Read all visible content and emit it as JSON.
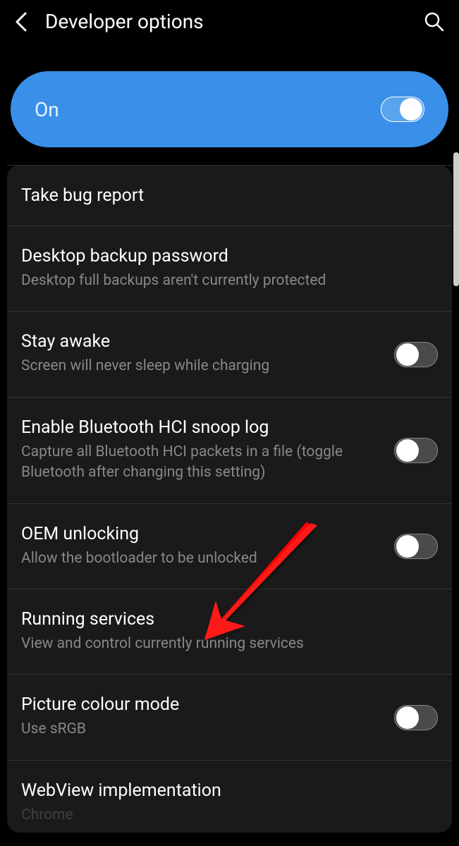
{
  "header": {
    "title": "Developer options"
  },
  "masterToggle": {
    "label": "On",
    "state": "on"
  },
  "settings": [
    {
      "title": "Take bug report",
      "subtitle": "",
      "hasToggle": false
    },
    {
      "title": "Desktop backup password",
      "subtitle": "Desktop full backups aren't currently protected",
      "hasToggle": false
    },
    {
      "title": "Stay awake",
      "subtitle": "Screen will never sleep while charging",
      "hasToggle": true,
      "toggleState": "off"
    },
    {
      "title": "Enable Bluetooth HCI snoop log",
      "subtitle": "Capture all Bluetooth HCI packets in a file (toggle Bluetooth after changing this setting)",
      "hasToggle": true,
      "toggleState": "off"
    },
    {
      "title": "OEM unlocking",
      "subtitle": "Allow the bootloader to be unlocked",
      "hasToggle": true,
      "toggleState": "off"
    },
    {
      "title": "Running services",
      "subtitle": "View and control currently running services",
      "hasToggle": false
    },
    {
      "title": "Picture colour mode",
      "subtitle": "Use sRGB",
      "hasToggle": true,
      "toggleState": "off"
    },
    {
      "title": "WebView implementation",
      "subtitle": "Chrome",
      "hasToggle": false
    }
  ]
}
